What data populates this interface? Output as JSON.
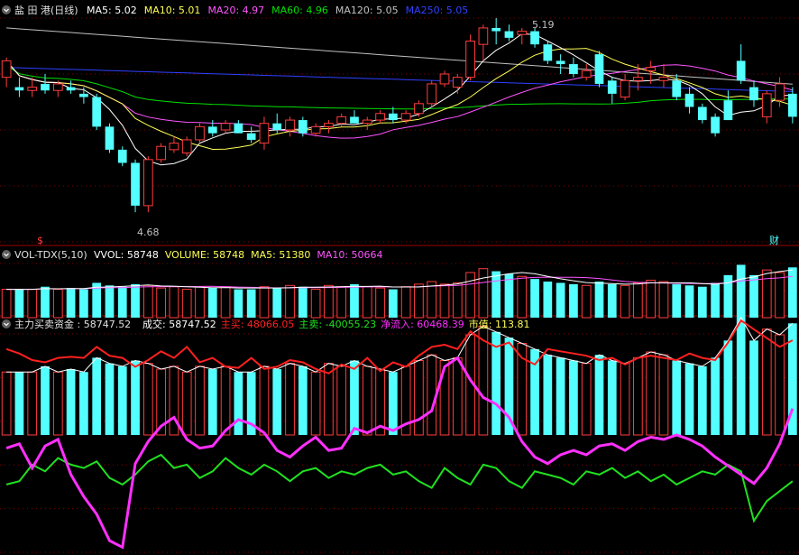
{
  "chart_data": {
    "type": "candlestick",
    "colors": {
      "up": "#ff3c3c",
      "down": "#54ffff",
      "ma5": "#ffffff",
      "ma10": "#ffff54",
      "ma20": "#ff54ff",
      "ma60": "#00e000",
      "ma120": "#c0c0c0",
      "ma250": "#3040ff",
      "vol_ma5": "#ffffff",
      "vol_ma10": "#ff54ff",
      "main_buy": "#ff2020",
      "main_sell": "#20e020",
      "net_inflow": "#ff30ff",
      "grid": "#800000",
      "axis_text": "#c0c0c0"
    },
    "panels": [
      {
        "name": "price",
        "title": "盐 田 港(日线)",
        "indicators": [
          {
            "label": "MA5: 5.02",
            "color": "#ffffff"
          },
          {
            "label": "MA10: 5.01",
            "color": "#ffff54"
          },
          {
            "label": "MA20: 4.97",
            "color": "#ff54ff"
          },
          {
            "label": "MA60: 4.96",
            "color": "#00e000"
          },
          {
            "label": "MA120: 5.05",
            "color": "#c0c0c0"
          },
          {
            "label": "MA250: 5.05",
            "color": "#3040ff"
          }
        ],
        "annotations": {
          "high": "5.19",
          "low": "4.68",
          "marker_s": "$",
          "marker_cai": "财"
        }
      },
      {
        "name": "volume",
        "title": "VOL-TDX(5,10)",
        "indicators": [
          {
            "label": "VVOL: 58748",
            "color": "#ffffff"
          },
          {
            "label": "VOLUME: 58748",
            "color": "#ffff54"
          },
          {
            "label": "MA5: 51380",
            "color": "#ffff54"
          },
          {
            "label": "MA10: 50664",
            "color": "#ff54ff"
          }
        ]
      },
      {
        "name": "funds",
        "title": "主力买卖资金 : 58747.52",
        "indicators": [
          {
            "label": "成交: 58747.52",
            "color": "#ffffff"
          },
          {
            "label": "主买: 48066.05",
            "color": "#ff2020"
          },
          {
            "label": "主卖: -40055.23",
            "color": "#20e020"
          },
          {
            "label": "净流入: 60468.39",
            "color": "#ff30ff"
          },
          {
            "label": "市值: 113.81",
            "color": "#ffff54"
          }
        ]
      }
    ],
    "price_range": [
      4.6,
      5.28
    ],
    "candles": [
      [
        5.1,
        5.16,
        5.07,
        5.15
      ],
      [
        5.07,
        5.1,
        5.04,
        5.06
      ],
      [
        5.06,
        5.1,
        5.04,
        5.07
      ],
      [
        5.08,
        5.11,
        5.05,
        5.06
      ],
      [
        5.06,
        5.09,
        5.04,
        5.08
      ],
      [
        5.07,
        5.09,
        5.05,
        5.06
      ],
      [
        5.05,
        5.07,
        5.02,
        5.04
      ],
      [
        5.04,
        5.05,
        4.94,
        4.95
      ],
      [
        4.95,
        4.96,
        4.87,
        4.88
      ],
      [
        4.88,
        4.89,
        4.83,
        4.84
      ],
      [
        4.84,
        4.85,
        4.69,
        4.71
      ],
      [
        4.71,
        4.86,
        4.69,
        4.85
      ],
      [
        4.85,
        4.9,
        4.84,
        4.89
      ],
      [
        4.88,
        4.92,
        4.87,
        4.9
      ],
      [
        4.87,
        4.92,
        4.86,
        4.91
      ],
      [
        4.91,
        4.96,
        4.9,
        4.95
      ],
      [
        4.95,
        4.97,
        4.92,
        4.93
      ],
      [
        4.94,
        4.97,
        4.93,
        4.96
      ],
      [
        4.96,
        4.97,
        4.93,
        4.93
      ],
      [
        4.93,
        4.95,
        4.9,
        4.91
      ],
      [
        4.9,
        4.98,
        4.88,
        4.96
      ],
      [
        4.96,
        4.99,
        4.93,
        4.94
      ],
      [
        4.94,
        4.98,
        4.92,
        4.97
      ],
      [
        4.97,
        4.98,
        4.92,
        4.93
      ],
      [
        4.93,
        4.96,
        4.92,
        4.95
      ],
      [
        4.95,
        4.97,
        4.93,
        4.96
      ],
      [
        4.96,
        4.99,
        4.95,
        4.98
      ],
      [
        4.98,
        5.0,
        4.96,
        4.96
      ],
      [
        4.96,
        4.98,
        4.94,
        4.97
      ],
      [
        4.97,
        5.0,
        4.96,
        4.99
      ],
      [
        4.99,
        5.01,
        4.96,
        4.97
      ],
      [
        4.97,
        5.0,
        4.96,
        4.99
      ],
      [
        4.99,
        5.03,
        4.98,
        5.02
      ],
      [
        5.02,
        5.09,
        5.01,
        5.08
      ],
      [
        5.08,
        5.12,
        5.07,
        5.11
      ],
      [
        5.07,
        5.11,
        5.05,
        5.1
      ],
      [
        5.1,
        5.23,
        5.09,
        5.21
      ],
      [
        5.2,
        5.26,
        5.15,
        5.25
      ],
      [
        5.25,
        5.28,
        5.2,
        5.24
      ],
      [
        5.24,
        5.26,
        5.21,
        5.22
      ],
      [
        5.23,
        5.25,
        5.2,
        5.24
      ],
      [
        5.24,
        5.25,
        5.19,
        5.2
      ],
      [
        5.2,
        5.21,
        5.14,
        5.15
      ],
      [
        5.15,
        5.17,
        5.11,
        5.14
      ],
      [
        5.14,
        5.16,
        5.1,
        5.11
      ],
      [
        5.1,
        5.14,
        5.09,
        5.12
      ],
      [
        5.17,
        5.18,
        5.07,
        5.08
      ],
      [
        5.09,
        5.1,
        5.02,
        5.05
      ],
      [
        5.04,
        5.11,
        5.03,
        5.09
      ],
      [
        5.09,
        5.14,
        5.06,
        5.1
      ],
      [
        5.12,
        5.15,
        5.08,
        5.13
      ],
      [
        5.09,
        5.14,
        5.07,
        5.1
      ],
      [
        5.09,
        5.11,
        5.03,
        5.04
      ],
      [
        5.05,
        5.07,
        4.99,
        5.01
      ],
      [
        5.01,
        5.02,
        4.96,
        4.97
      ],
      [
        4.98,
        4.99,
        4.92,
        4.93
      ],
      [
        5.03,
        5.06,
        4.97,
        4.97
      ],
      [
        5.15,
        5.2,
        5.08,
        5.09
      ],
      [
        5.07,
        5.09,
        5.01,
        5.03
      ],
      [
        4.98,
        5.06,
        4.96,
        5.05
      ],
      [
        5.03,
        5.1,
        5.01,
        5.08
      ],
      [
        5.05,
        5.07,
        4.96,
        4.98
      ]
    ],
    "volume": [
      22,
      22,
      22,
      24,
      22,
      23,
      22,
      27,
      25,
      24,
      26,
      25,
      23,
      24,
      22,
      24,
      23,
      24,
      22,
      22,
      24,
      23,
      25,
      24,
      22,
      25,
      24,
      26,
      24,
      23,
      22,
      24,
      26,
      28,
      26,
      27,
      35,
      38,
      36,
      34,
      32,
      30,
      28,
      27,
      26,
      25,
      28,
      26,
      25,
      27,
      29,
      28,
      26,
      25,
      24,
      27,
      33,
      41,
      33,
      37,
      35,
      39
    ],
    "main_buy": [
      78,
      74,
      68,
      66,
      70,
      71,
      70,
      80,
      72,
      70,
      62,
      68,
      76,
      70,
      80,
      66,
      70,
      62,
      61,
      70,
      60,
      62,
      68,
      66,
      60,
      56,
      64,
      60,
      70,
      58,
      66,
      62,
      72,
      80,
      82,
      78,
      94,
      86,
      80,
      84,
      70,
      64,
      78,
      76,
      74,
      72,
      68,
      70,
      64,
      70,
      72,
      70,
      68,
      74,
      70,
      68,
      84,
      104,
      96,
      88,
      80,
      86
    ],
    "main_sell": [
      -30,
      -28,
      -18,
      -22,
      -14,
      -18,
      -20,
      -16,
      -26,
      -30,
      -24,
      -16,
      -12,
      -20,
      -18,
      -26,
      -22,
      -14,
      -20,
      -24,
      -18,
      -22,
      -28,
      -22,
      -20,
      -26,
      -22,
      -24,
      -20,
      -18,
      -24,
      -22,
      -28,
      -32,
      -20,
      -26,
      -30,
      -18,
      -20,
      -28,
      -32,
      -22,
      -24,
      -26,
      -30,
      -22,
      -24,
      -20,
      -26,
      -22,
      -28,
      -24,
      -30,
      -26,
      -22,
      -24,
      -18,
      -22,
      -52,
      -40,
      -34,
      -28
    ],
    "net_inflow": [
      -12,
      -8,
      -30,
      -10,
      -4,
      -36,
      -56,
      -72,
      -96,
      -102,
      -26,
      -6,
      8,
      16,
      -4,
      -12,
      -10,
      4,
      14,
      10,
      2,
      -14,
      -20,
      -10,
      -2,
      -14,
      -12,
      6,
      2,
      8,
      4,
      10,
      14,
      22,
      62,
      70,
      50,
      34,
      28,
      16,
      -6,
      -20,
      -26,
      -18,
      -14,
      -18,
      -10,
      -8,
      -14,
      -6,
      -2,
      -4,
      0,
      -4,
      -10,
      -20,
      -28,
      -36,
      -44,
      -30,
      -8,
      24
    ]
  }
}
